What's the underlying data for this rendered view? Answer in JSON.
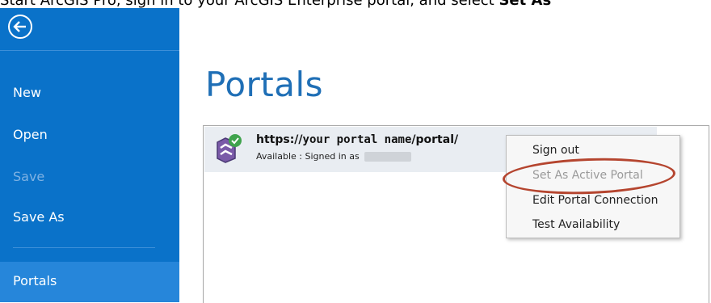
{
  "caption": {
    "text": "Start ArcGIS Pro, sign in to your ArcGIS Enterprise portal, and select ",
    "bold": "Set As"
  },
  "sidebar": {
    "back_icon": "back-arrow-icon",
    "items": [
      {
        "label": "New",
        "enabled": true
      },
      {
        "label": "Open",
        "enabled": true
      },
      {
        "label": "Save",
        "enabled": false
      },
      {
        "label": "Save As",
        "enabled": true
      }
    ],
    "selected": {
      "label": "Portals"
    }
  },
  "main": {
    "title": "Portals",
    "portal": {
      "url_prefix": "https://",
      "url_name": "your portal name",
      "url_suffix": "/portal/",
      "status": "Available : Signed in as",
      "icon": "portal-connected-icon"
    }
  },
  "context_menu": {
    "items": [
      {
        "label": "Sign out",
        "enabled": true
      },
      {
        "label": "Set As Active Portal",
        "enabled": false
      },
      {
        "label": "Edit Portal Connection",
        "enabled": true
      },
      {
        "label": "Test Availability",
        "enabled": true
      }
    ]
  },
  "colors": {
    "sidebar": "#0a72c9",
    "selected": "#2686da",
    "title": "#1f6fb6",
    "highlight": "#b5452f"
  }
}
